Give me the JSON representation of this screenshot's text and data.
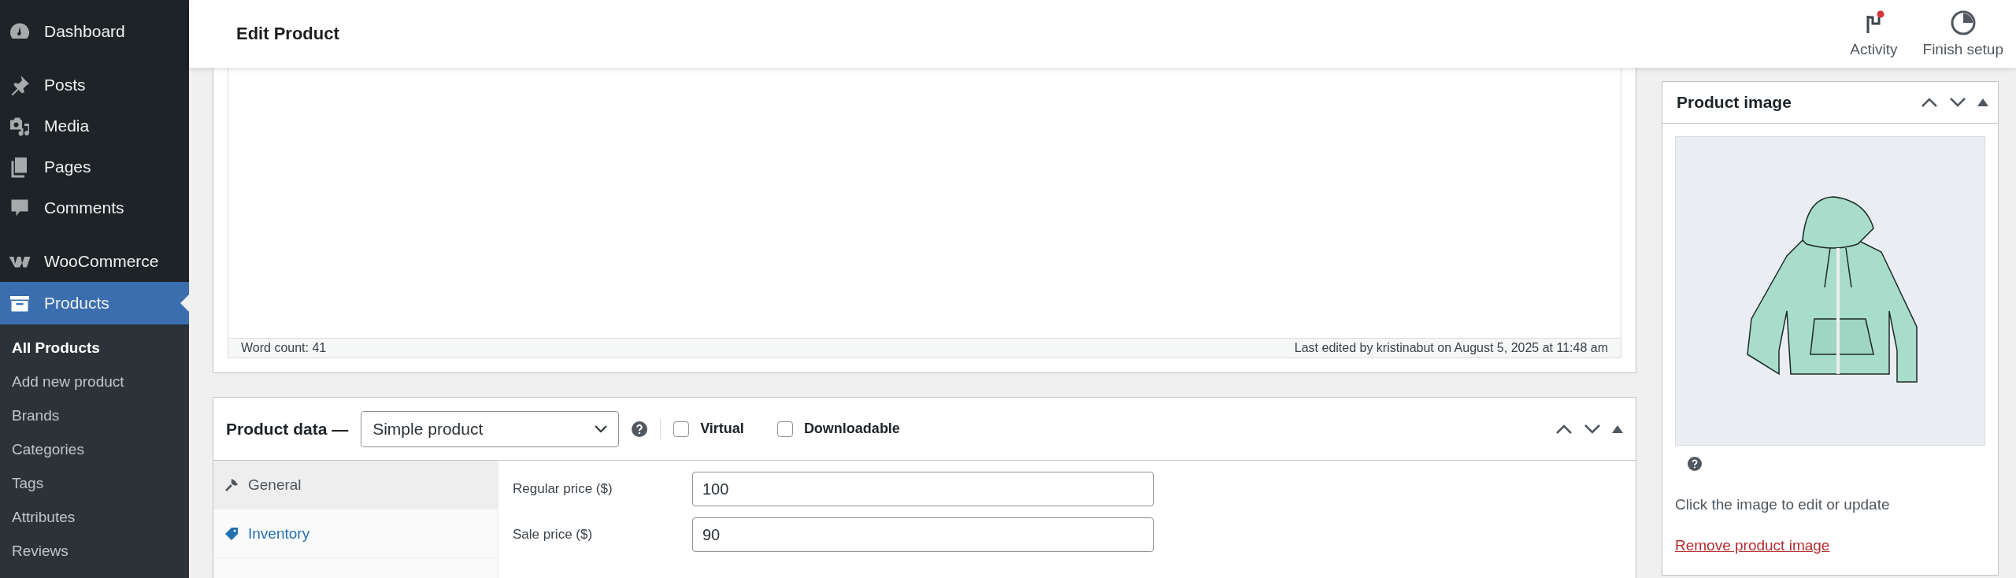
{
  "sidebar": {
    "items": [
      {
        "label": "Dashboard",
        "kind": "dashboard",
        "selected": false
      },
      {
        "label": "Posts",
        "kind": "posts",
        "selected": false
      },
      {
        "label": "Media",
        "kind": "media",
        "selected": false
      },
      {
        "label": "Pages",
        "kind": "pages",
        "selected": false
      },
      {
        "label": "Comments",
        "kind": "comments",
        "selected": false
      },
      {
        "label": "WooCommerce",
        "kind": "store",
        "selected": false
      },
      {
        "label": "Products",
        "kind": "products",
        "selected": true
      }
    ],
    "submenu": [
      {
        "label": "All Products",
        "selected": true
      },
      {
        "label": "Add new product",
        "selected": false
      },
      {
        "label": "Brands",
        "selected": false
      },
      {
        "label": "Categories",
        "selected": false
      },
      {
        "label": "Tags",
        "selected": false
      },
      {
        "label": "Attributes",
        "selected": false
      },
      {
        "label": "Reviews",
        "selected": false
      }
    ]
  },
  "topbar": {
    "title": "Edit Product",
    "actions": [
      {
        "label": "Activity",
        "kind": "activity",
        "badge": true
      },
      {
        "label": "Finish setup",
        "kind": "setup",
        "badge": false
      }
    ]
  },
  "editor": {
    "word_count": "Word count: 41",
    "last_edited": "Last edited by kristinabut on August 5, 2025 at 11:48 am"
  },
  "product_data": {
    "title": "Product data —",
    "type": "Simple product",
    "options": [
      {
        "label": "Virtual",
        "checked": false
      },
      {
        "label": "Downloadable",
        "checked": false
      }
    ],
    "tabs": [
      {
        "label": "General",
        "kind": "general",
        "selected": true
      },
      {
        "label": "Inventory",
        "kind": "inventory",
        "selected": false
      }
    ],
    "fields": [
      {
        "label": "Regular price ($)",
        "value": "100"
      },
      {
        "label": "Sale price ($)",
        "value": "90"
      }
    ]
  },
  "product_image": {
    "title": "Product image",
    "hint": "Click the image to edit or update",
    "remove_link": "Remove product image"
  }
}
